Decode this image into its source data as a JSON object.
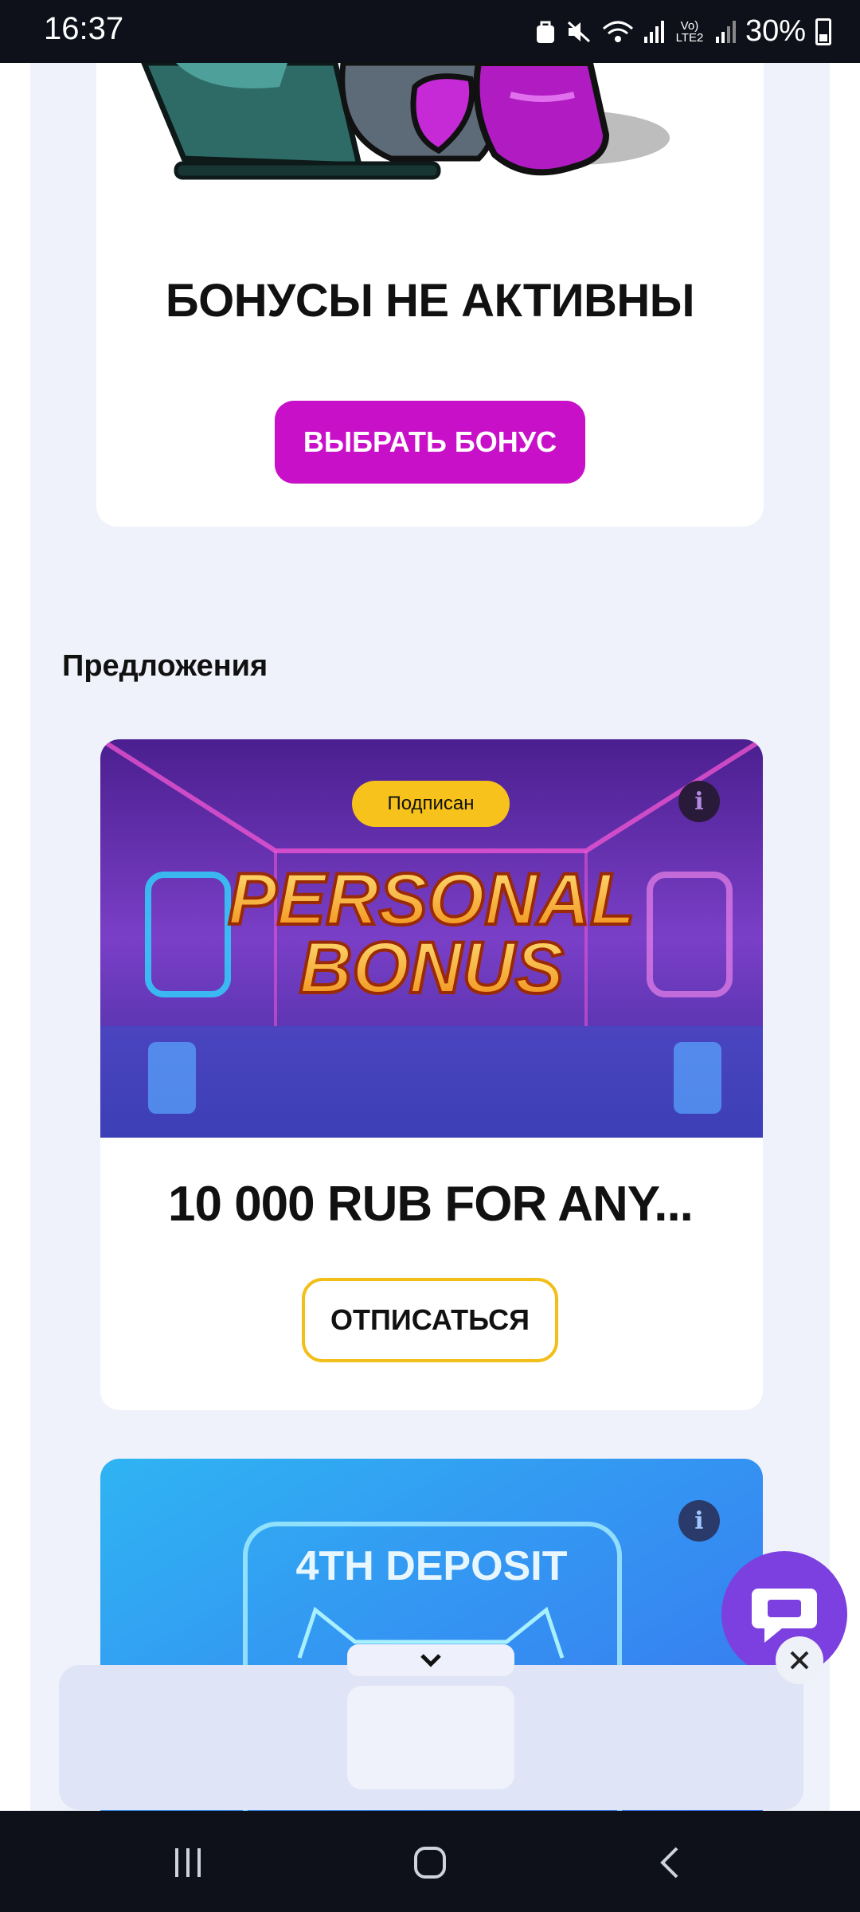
{
  "status_bar": {
    "time": "16:37",
    "battery_text": "30%",
    "lte_label": "Vo) LTE2",
    "icons": [
      "bag-icon",
      "mute-icon",
      "wifi-icon",
      "signal-icon",
      "lte-icon",
      "signal2-icon",
      "battery-icon"
    ]
  },
  "bonus_status": {
    "title": "БОНУСЫ НЕ АКТИВНЫ",
    "choose_button": "ВЫБРАТЬ БОНУС"
  },
  "offers": {
    "section_title": "Предложения",
    "items": [
      {
        "badge": "Подписан",
        "image_title_line1": "PERSONAL",
        "image_title_line2": "BONUS",
        "title": "10 000 RUB FOR ANY...",
        "button": "ОТПИСАТЬСЯ",
        "info": "i"
      },
      {
        "image_title": "4TH DEPOSIT",
        "info": "i"
      }
    ]
  },
  "colors": {
    "accent_magenta": "#c810c8",
    "badge_yellow": "#f7c21b",
    "chat_purple": "#7c3fe0",
    "page_bg": "#eff2fa"
  },
  "nav": {
    "icons": [
      "recent-apps-icon",
      "home-icon",
      "back-icon"
    ]
  }
}
